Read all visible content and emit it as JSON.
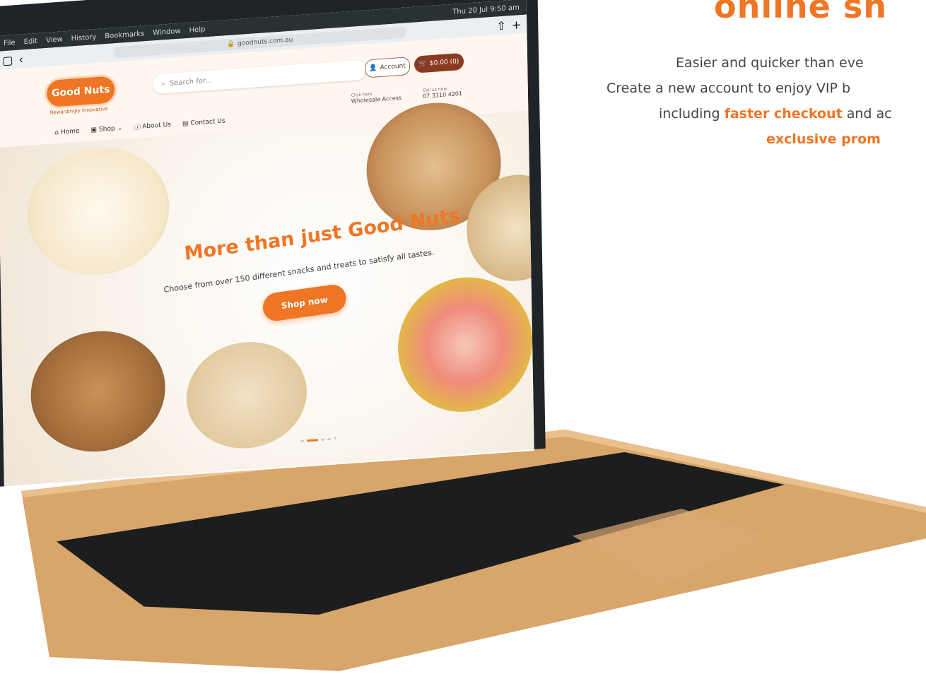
{
  "promo": {
    "heading": "online sh",
    "line1": "Easier and quicker than eve",
    "line2": "Create a new account to enjoy VIP b",
    "line3_prefix": "including ",
    "line3_bold": "faster checkout",
    "line3_suffix": " and ac",
    "line4_bold": "exclusive prom"
  },
  "macos": {
    "menu": [
      "File",
      "Edit",
      "View",
      "History",
      "Bookmarks",
      "Window",
      "Help"
    ],
    "clock": "Thu 20 Jul 9:50 am",
    "url": "goodnuts.com.au"
  },
  "site": {
    "logo": "Good Nuts",
    "tagline": "Rewardingly Innovative",
    "search_placeholder": "Search for...",
    "account_label": "Account",
    "cart_label": "$0.00 (0)",
    "nav": [
      "Home",
      "Shop",
      "About Us",
      "Contact Us"
    ],
    "wholesale_small": "Click here",
    "wholesale_label": "Wholesale Access",
    "call_small": "Call us now",
    "call_number": "07 3310 4201"
  },
  "hero": {
    "title": "More than just Good Nuts",
    "subtitle": "Choose from over 150 different snacks and treats to satisfy all tastes.",
    "button": "Shop now"
  },
  "colors": {
    "accent": "#ee7624",
    "brown": "#8b3a22",
    "laptop_gold": "#d9a973",
    "bezel": "#1e2427"
  },
  "icons": [
    "search-icon",
    "user-icon",
    "cart-icon",
    "home-icon",
    "shop-icon",
    "info-icon",
    "contact-icon",
    "store-icon",
    "phone-icon"
  ]
}
